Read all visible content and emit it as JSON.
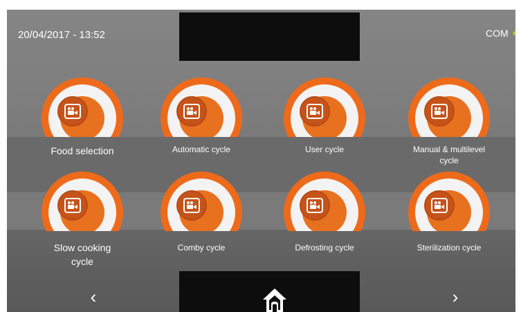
{
  "status": {
    "datetime": "20/04/2017 - 13:52",
    "com_label": "COM",
    "com_color": "#9acd32"
  },
  "accent_color": "#ee6a1b",
  "tiles": [
    {
      "label": "Food selection",
      "icon": "video-camera-icon"
    },
    {
      "label": "Automatic cycle",
      "icon": "video-camera-icon"
    },
    {
      "label": "User cycle",
      "icon": "video-camera-icon"
    },
    {
      "label": "Manual & multilevel cycle",
      "icon": "video-camera-icon"
    },
    {
      "label": "Slow cooking cycle",
      "icon": "video-camera-icon"
    },
    {
      "label": "Comby cycle",
      "icon": "video-camera-icon"
    },
    {
      "label": "Defrosting cycle",
      "icon": "video-camera-icon"
    },
    {
      "label": "Sterilization cycle",
      "icon": "video-camera-icon"
    }
  ],
  "nav": {
    "prev": "‹",
    "next": "›",
    "home_icon": "home-icon"
  }
}
